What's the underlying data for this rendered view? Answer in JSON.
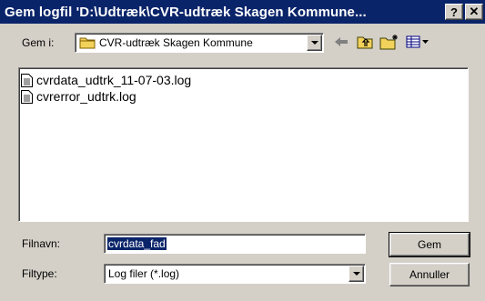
{
  "window": {
    "title": "Gem logfil 'D:\\Udtræk\\CVR-udtræk Skagen Kommune...",
    "help_btn": "?",
    "close_btn": "✕"
  },
  "location": {
    "label": "Gem i:",
    "value": "CVR-udtræk Skagen Kommune"
  },
  "toolbar": {
    "back_icon": "back-arrow-icon",
    "up_icon": "up-folder-icon",
    "new_folder_icon": "new-folder-icon",
    "view_icon": "view-menu-icon"
  },
  "files": [
    {
      "name": "cvrdata_udtrk_11-07-03.log"
    },
    {
      "name": "cvrerror_udtrk.log"
    }
  ],
  "filename": {
    "label": "Filnavn:",
    "value": "cvrdata_fad"
  },
  "filetype": {
    "label": "Filtype:",
    "value": "Log filer (*.log)"
  },
  "buttons": {
    "save": "Gem",
    "cancel": "Annuller"
  },
  "colors": {
    "titlebar": "#0a246a",
    "face": "#d4d0c8",
    "folder": "#f2d25b"
  }
}
